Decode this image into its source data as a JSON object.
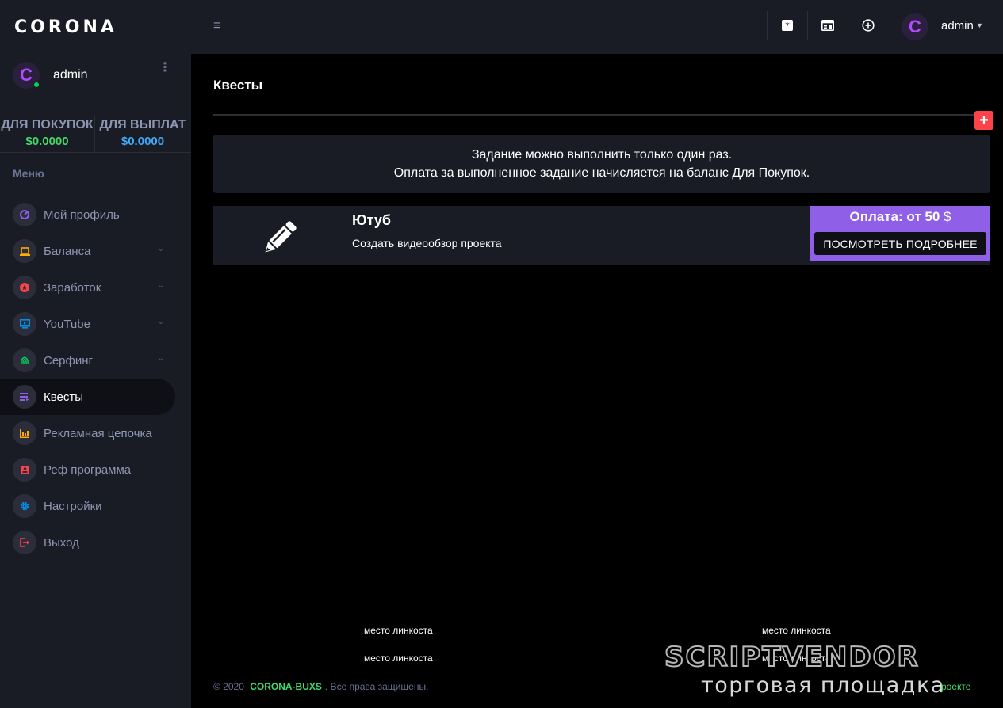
{
  "brand": "CORONA",
  "profile": {
    "name": "admin",
    "avatar_letter": "C",
    "more": "⋮"
  },
  "balances": [
    {
      "label": "ДЛЯ ПОКУПОК",
      "value": "$0.0000",
      "color": "#3fdc6b"
    },
    {
      "label": "ДЛЯ ВЫПЛАТ",
      "value": "$0.0000",
      "color": "#3fa9f5"
    }
  ],
  "menu_title": "Меню",
  "nav": [
    {
      "label": "Мой профиль",
      "icon": "speedometer-icon",
      "color": "#8f5fe8",
      "chevron": false
    },
    {
      "label": "Баланса",
      "icon": "laptop-icon",
      "color": "#ffab00",
      "chevron": true
    },
    {
      "label": "Заработок",
      "icon": "star-circle-icon",
      "color": "#fc424a",
      "chevron": true
    },
    {
      "label": "YouTube",
      "icon": "monitor-play-icon",
      "color": "#0090e7",
      "chevron": true
    },
    {
      "label": "Серфинг",
      "icon": "fingerprint-icon",
      "color": "#00d25b",
      "chevron": true
    },
    {
      "label": "Квесты",
      "icon": "list-icon",
      "color": "#8f5fe8",
      "chevron": false,
      "active": true
    },
    {
      "label": "Рекламная цепочка",
      "icon": "chart-bar-icon",
      "color": "#ffab00",
      "chevron": false
    },
    {
      "label": "Реф программа",
      "icon": "contact-card-icon",
      "color": "#fc424a",
      "chevron": false
    },
    {
      "label": "Настройки",
      "icon": "gear-icon",
      "color": "#0090e7",
      "chevron": false
    },
    {
      "label": "Выход",
      "icon": "logout-icon",
      "color": "#fc424a",
      "chevron": false
    }
  ],
  "topbar": {
    "user": "admin",
    "avatar_letter": "C"
  },
  "page": {
    "title": "Квесты",
    "add_symbol": "+"
  },
  "notice": {
    "line1": "Задание можно выполнить только один раз.",
    "line2": "Оплата за выполненное задание начисляется на баланс Для Покупок."
  },
  "quests": [
    {
      "title": "Ютуб",
      "description": "Создать видеообзор проекта",
      "pay_prefix": "Оплата: от 50",
      "pay_currency": "$",
      "button": "ПОСМОТРЕТЬ ПОДРОБНЕЕ"
    }
  ],
  "link_spots": [
    "место линкоста",
    "место линкоста",
    "место линкоста",
    "место линкоста"
  ],
  "footer": {
    "prefix": "© 2020",
    "brand": "CORONA-BUXS",
    "suffix": ". Все права защищены.",
    "right": "роекте"
  },
  "watermark": {
    "top": "SCRIPTVENDOR",
    "bottom": "торговая площадка"
  }
}
